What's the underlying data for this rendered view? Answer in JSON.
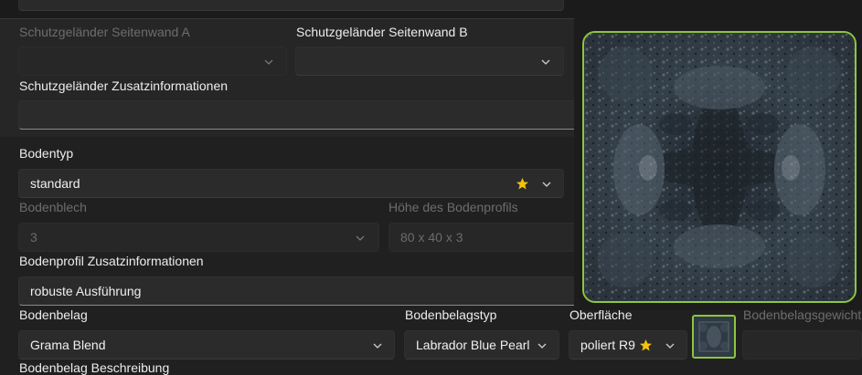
{
  "guard_wall_a": {
    "label": "Schutzgeländer Seitenwand A",
    "value": ""
  },
  "guard_wall_b": {
    "label": "Schutzgeländer Seitenwand B",
    "value": ""
  },
  "guard_info": {
    "label": "Schutzgeländer Zusatzinformationen",
    "value": ""
  },
  "floor_type": {
    "label": "Bodentyp",
    "value": "standard"
  },
  "floor_sheet": {
    "label": "Bodenblech",
    "value": "3"
  },
  "floor_profile_height": {
    "label": "Höhe des Bodenprofils",
    "value": "80 x 40 x 3"
  },
  "floor_profile_info": {
    "label": "Bodenprofil Zusatzinformationen",
    "value": "robuste Ausführung"
  },
  "floor_covering": {
    "label": "Bodenbelag",
    "value": "Grama Blend"
  },
  "floor_covering_type": {
    "label": "Bodenbelagstyp",
    "value": "Labrador Blue Pearl"
  },
  "surface": {
    "label": "Oberfläche",
    "value": "poliert R9"
  },
  "floor_covering_weight": {
    "label": "Bodenbelagsgewicht",
    "value": ""
  },
  "floor_covering_desc": {
    "label": "Bodenbelag Beschreibung"
  },
  "colors": {
    "accent_green": "#8ec63f",
    "star": "#f4c20d",
    "background": "#202020"
  },
  "icons": [
    "chevron-down-icon",
    "star-icon"
  ]
}
